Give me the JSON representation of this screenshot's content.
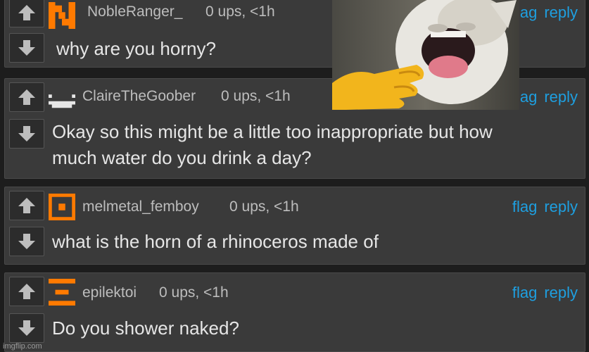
{
  "colors": {
    "background": "#1d1d1d",
    "panel": "#3a3a3a",
    "link": "#1e9fe0",
    "avatar_orange": "#ff7a00"
  },
  "comments": [
    {
      "username": "NobleRanger_",
      "meta": "0 ups, <1h",
      "flag": "flag",
      "reply": "reply",
      "text": "why are you horny?",
      "avatar_icon": "pixel-avatar-n-icon"
    },
    {
      "username": "ClaireTheGoober",
      "meta": "0 ups, <1h",
      "flag": "flag",
      "reply": "reply",
      "text_line1": "Okay so this might be a little too inappropriate but how",
      "text_line2": "much water do you drink a day?",
      "avatar_icon": "pixel-avatar-face-icon"
    },
    {
      "username": "melmetal_femboy",
      "meta": "0 ups, <1h",
      "flag": "flag",
      "reply": "reply",
      "text": "what is the horn of a rhinoceros made of",
      "avatar_icon": "pixel-avatar-square-icon"
    },
    {
      "username": "epilektoi",
      "meta": "0 ups, <1h",
      "flag": "flag",
      "reply": "reply",
      "text": "Do you shower naked?",
      "avatar_icon": "pixel-avatar-e-icon"
    }
  ],
  "overlay_image": "laughing-cat-meme",
  "watermark": "imgflip.com"
}
